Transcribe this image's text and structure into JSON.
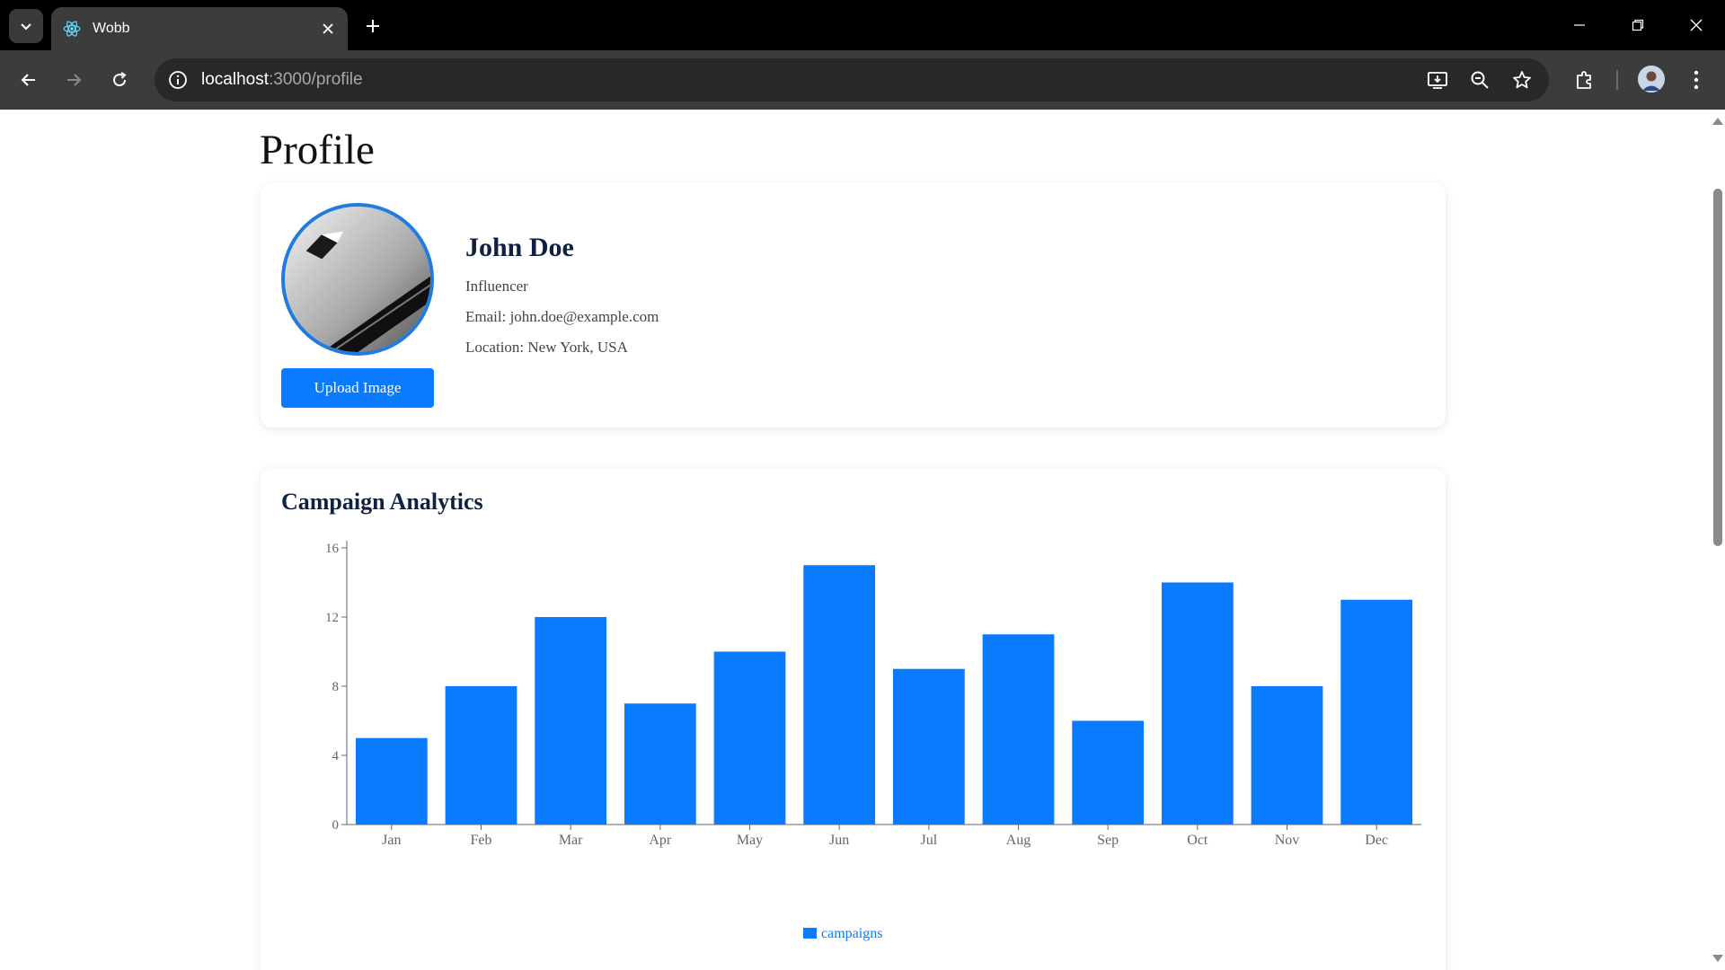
{
  "browser": {
    "tab_title": "Wobb",
    "url_host": "localhost",
    "url_rest": ":3000/profile"
  },
  "page": {
    "title": "Profile"
  },
  "profile": {
    "name": "John Doe",
    "role": "Influencer",
    "email": "Email: john.doe@example.com",
    "location": "Location: New York, USA",
    "upload_label": "Upload Image"
  },
  "analytics": {
    "title": "Campaign Analytics"
  },
  "colors": {
    "accent": "#0a7bff",
    "heading": "#0f2040"
  },
  "chart_data": {
    "type": "bar",
    "categories": [
      "Jan",
      "Feb",
      "Mar",
      "Apr",
      "May",
      "Jun",
      "Jul",
      "Aug",
      "Sep",
      "Oct",
      "Nov",
      "Dec"
    ],
    "series": [
      {
        "name": "campaigns",
        "values": [
          5,
          8,
          12,
          7,
          10,
          15,
          9,
          11,
          6,
          14,
          8,
          13
        ]
      }
    ],
    "title": "",
    "xlabel": "",
    "ylabel": "",
    "ylim": [
      0,
      16
    ],
    "yticks": [
      0,
      4,
      8,
      12,
      16
    ],
    "grid": false,
    "legend": "bottom"
  }
}
